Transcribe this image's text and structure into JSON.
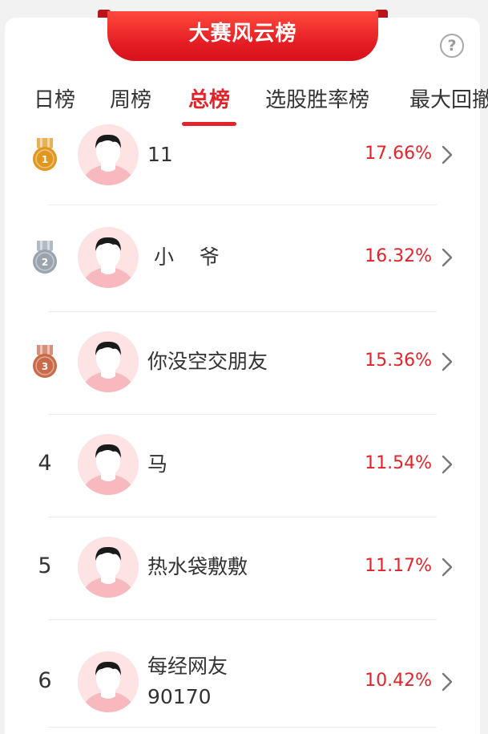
{
  "banner": {
    "title": "大赛风云榜"
  },
  "help": {
    "label": "?"
  },
  "tabs": [
    {
      "label": "日榜"
    },
    {
      "label": "周榜"
    },
    {
      "label": "总榜"
    },
    {
      "label": "选股胜率榜"
    },
    {
      "label": "最大回撤"
    }
  ],
  "active_tab": "总榜",
  "colors": {
    "accent": "#e2232a",
    "gold": "#e0961f",
    "silver": "#9aa4ae",
    "bronze": "#c96a4a"
  },
  "rankings": [
    {
      "rank": "1",
      "medal": "gold",
      "name": "11",
      "name2": "",
      "pct": "17.66%"
    },
    {
      "rank": "2",
      "medal": "silver",
      "name": " 小    爷",
      "name2": "",
      "pct": "16.32%"
    },
    {
      "rank": "3",
      "medal": "bronze",
      "name": "你没空交朋友",
      "name2": "",
      "pct": "15.36%"
    },
    {
      "rank": "4",
      "medal": "",
      "name": "马",
      "name2": "",
      "pct": "11.54%"
    },
    {
      "rank": "5",
      "medal": "",
      "name": "热水袋敷敷",
      "name2": "",
      "pct": "11.17%"
    },
    {
      "rank": "6",
      "medal": "",
      "name": "每经网友",
      "name2": "90170",
      "pct": "10.42%"
    }
  ]
}
